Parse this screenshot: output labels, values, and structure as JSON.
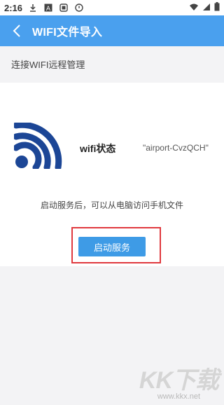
{
  "status_bar": {
    "time": "2:16",
    "icons": [
      "download-icon",
      "font-a-icon",
      "media-icon",
      "shield-icon",
      "wifi-icon",
      "signal-icon",
      "battery-icon"
    ]
  },
  "app_bar": {
    "title": "WIFI文件导入",
    "background_color": "#4aa0ee"
  },
  "section": {
    "header": "连接WIFI远程管理"
  },
  "wifi": {
    "label": "wifi状态",
    "value": "\"airport-CvzQCH\"",
    "logo_color": "#1c4696"
  },
  "hint": "启动服务后，可以从电脑访问手机文件",
  "start_button": {
    "label": "启动服务",
    "color": "#3e9be6",
    "highlight_color": "#e0393e"
  },
  "watermark": {
    "logo": "KK下载",
    "url": "www.kkx.net"
  }
}
